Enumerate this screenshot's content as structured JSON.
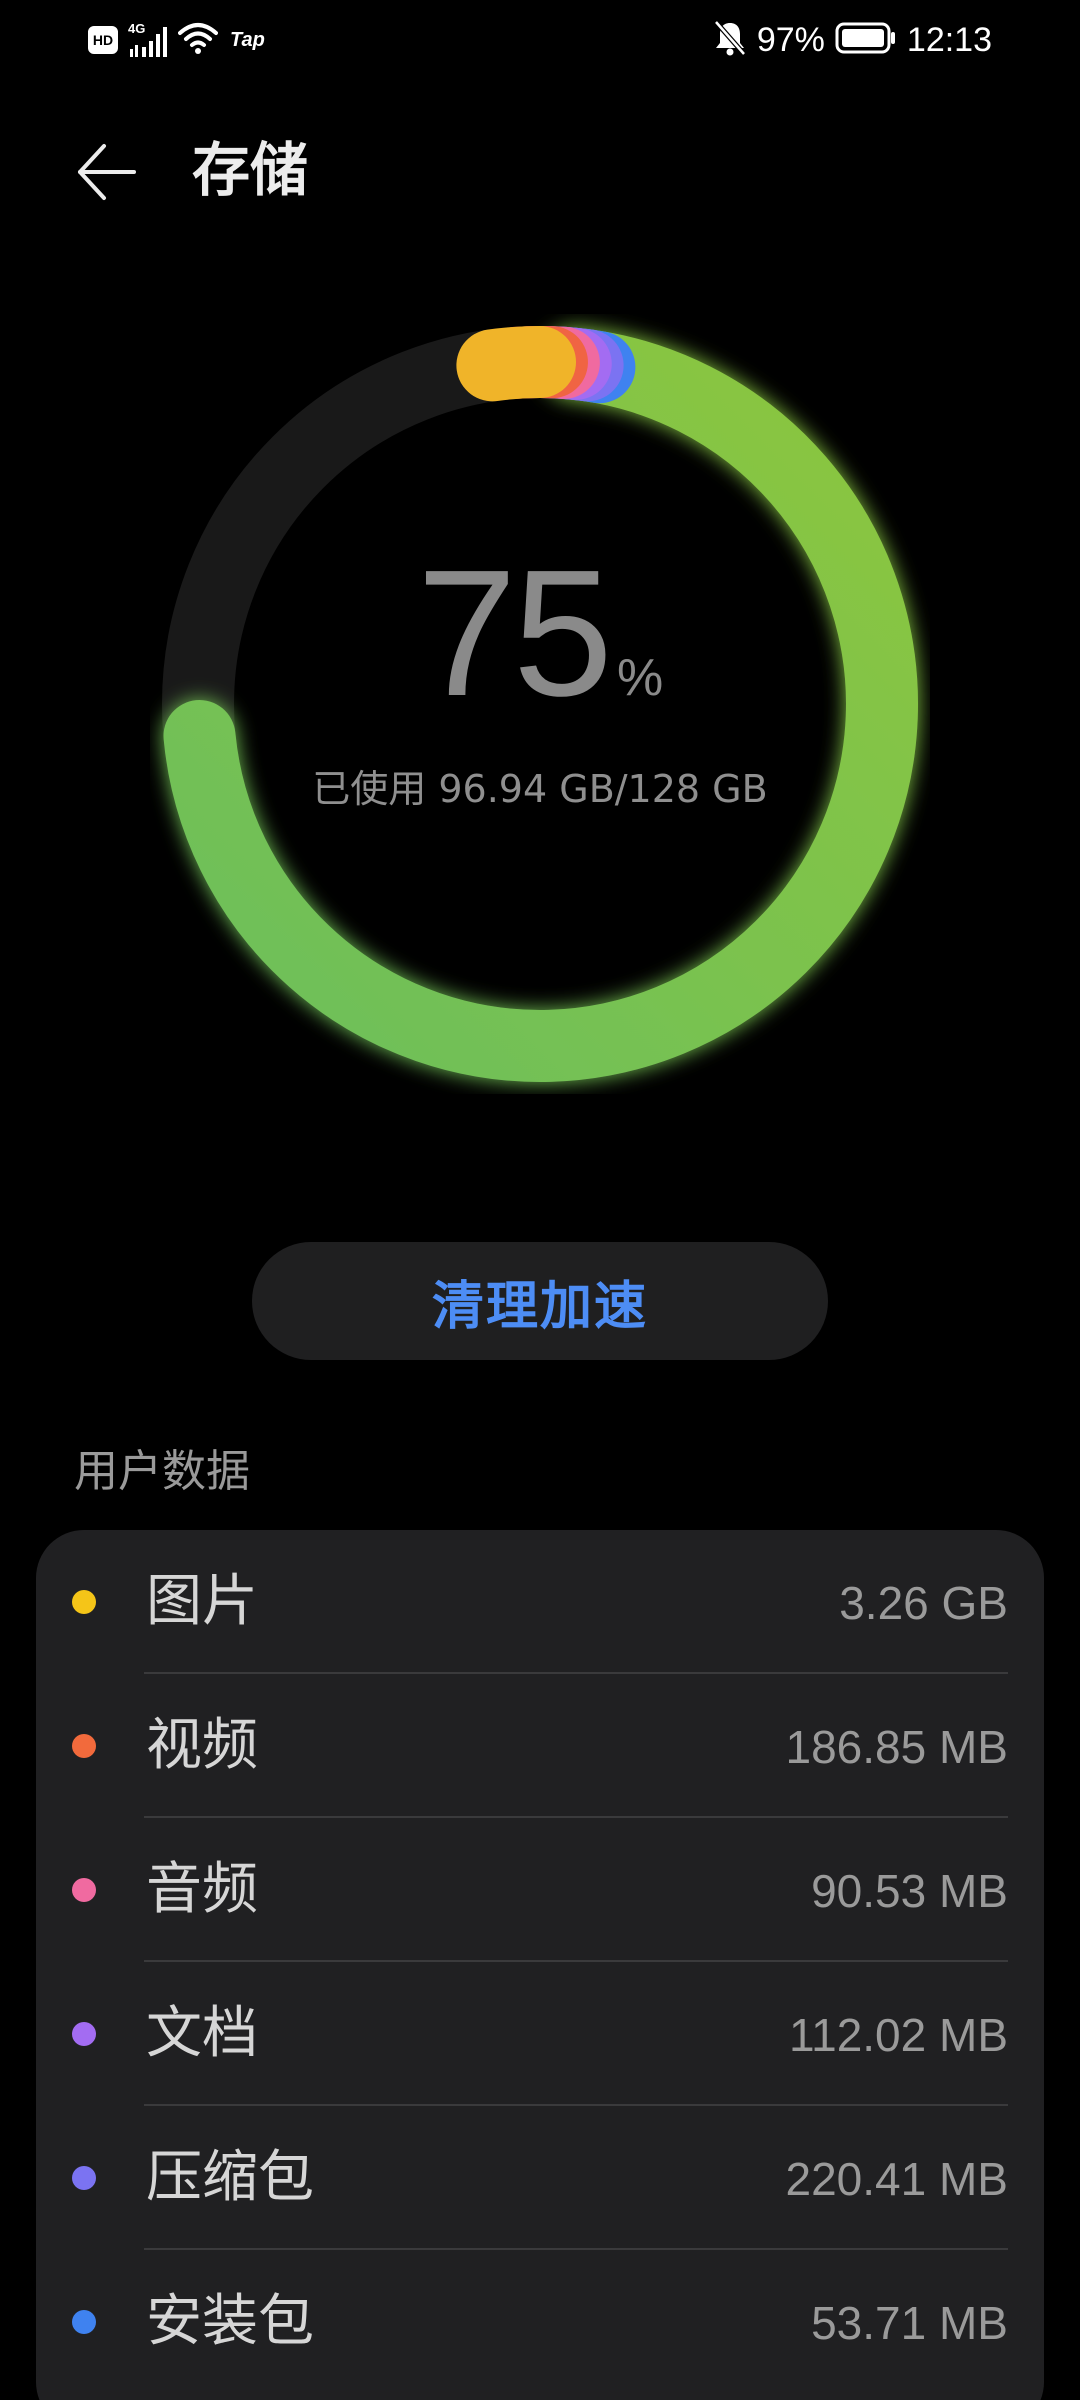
{
  "status_bar": {
    "hd": "HD",
    "network": "4G",
    "tap": "Tap",
    "battery_percent": "97%",
    "time": "12:13",
    "icons": [
      "hd-icon",
      "signal-icon",
      "wifi-icon",
      "mute-bell-icon",
      "battery-icon"
    ]
  },
  "header": {
    "back_icon": "arrow-left-icon",
    "title": "存储"
  },
  "storage": {
    "percent": "75",
    "percent_sign": "%",
    "usage_text": "已使用 96.94 GB/128 GB",
    "used_fraction": 0.7573,
    "colors": {
      "track": "#1a1a1a",
      "apps": "#7cc24c",
      "pictures": "#f0b429",
      "video": "#f06443",
      "audio": "#f06aa0",
      "docs": "#a36cf2",
      "archives": "#7b73f2",
      "installers": "#3f82f0"
    }
  },
  "clean_button": {
    "label": "清理加速"
  },
  "user_data": {
    "section_label": "用户数据",
    "items": [
      {
        "label": "图片",
        "size": "3.26 GB",
        "color": "#f5c518"
      },
      {
        "label": "视频",
        "size": "186.85 MB",
        "color": "#f26a3c"
      },
      {
        "label": "音频",
        "size": "90.53 MB",
        "color": "#f06aa0"
      },
      {
        "label": "文档",
        "size": "112.02 MB",
        "color": "#a36cf2"
      },
      {
        "label": "压缩包",
        "size": "220.41 MB",
        "color": "#7b73f2"
      },
      {
        "label": "安装包",
        "size": "53.71 MB",
        "color": "#3f82f0"
      }
    ]
  }
}
